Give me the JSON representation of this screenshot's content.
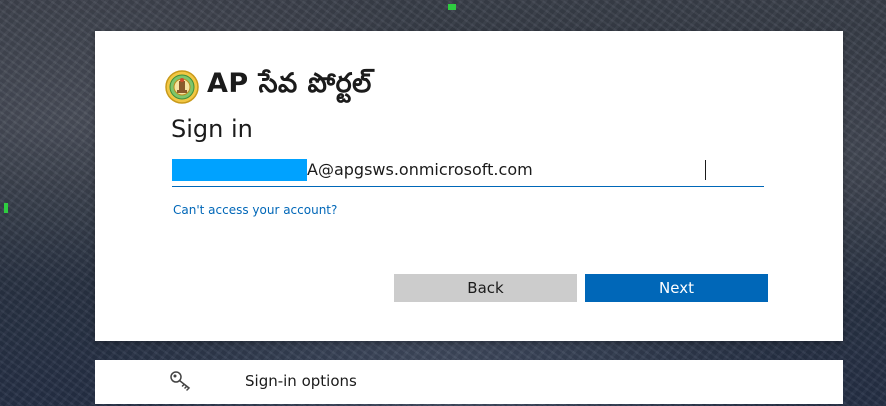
{
  "brand": {
    "name": "AP సేవ పోర్టల్",
    "emblem_icon": "ap-emblem-icon"
  },
  "signin": {
    "title": "Sign in",
    "email_value": "A@apgsws.onmicrosoft.com",
    "cant_access_link": "Can't access your account?",
    "back_label": "Back",
    "next_label": "Next"
  },
  "options": {
    "label": "Sign-in options",
    "icon": "key-icon"
  },
  "colors": {
    "accent": "#0067b8",
    "back_button": "#cccccc",
    "redaction": "#00a2ff",
    "card": "#ffffff"
  }
}
